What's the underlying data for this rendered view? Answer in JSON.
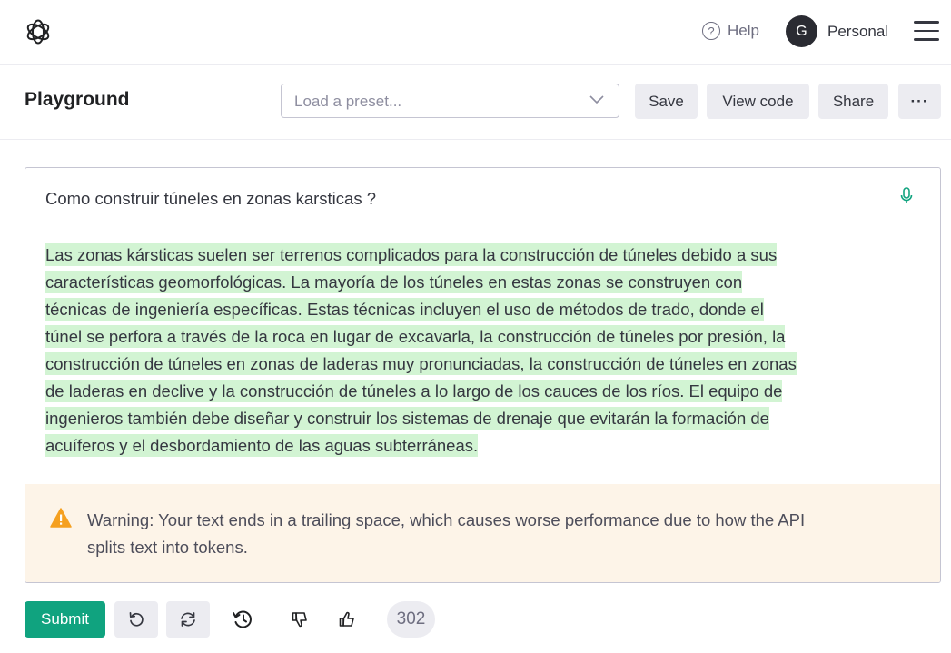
{
  "topbar": {
    "help_label": "Help",
    "help_icon": "question-circle-icon",
    "avatar_initial": "G",
    "account_name": "Personal"
  },
  "header": {
    "title": "Playground",
    "preset_placeholder": "Load a preset...",
    "preset_value": "",
    "save_label": "Save",
    "view_code_label": "View code",
    "share_label": "Share",
    "more_label": "···"
  },
  "editor": {
    "prompt": "Como construir túneles en zonas karsticas ?",
    "completion_lines": [
      "Las zonas kársticas suelen ser terrenos complicados para la construcción de túneles debido a sus",
      "características geomorfológicas. La mayoría de los túneles en estas zonas se construyen con",
      "técnicas de ingeniería específicas. Estas técnicas incluyen el uso de métodos de trado, donde el",
      "túnel se perfora a través de la roca en lugar de excavarla, la construcción de túneles por presión, la",
      "construcción de túneles en zonas de laderas muy pronunciadas, la construcción de túneles en zonas",
      "de laderas en declive y la construcción de túneles a lo largo de los cauces de los ríos. El equipo de",
      "ingenieros también debe diseñar y construir los sistemas de drenaje que evitarán la formación  de",
      "acuíferos y el desbordamiento de las aguas subterráneas."
    ],
    "warning_line1": "Warning: Your text ends in a trailing space, which causes worse performance due to how the API",
    "warning_line2": "splits text into tokens."
  },
  "footer": {
    "submit_label": "Submit",
    "token_count": "302"
  },
  "colors": {
    "accent": "#10a37f",
    "highlight": "#d2f4d3",
    "warning_bg": "#fdf4e8",
    "warning_icon": "#f5a020"
  }
}
